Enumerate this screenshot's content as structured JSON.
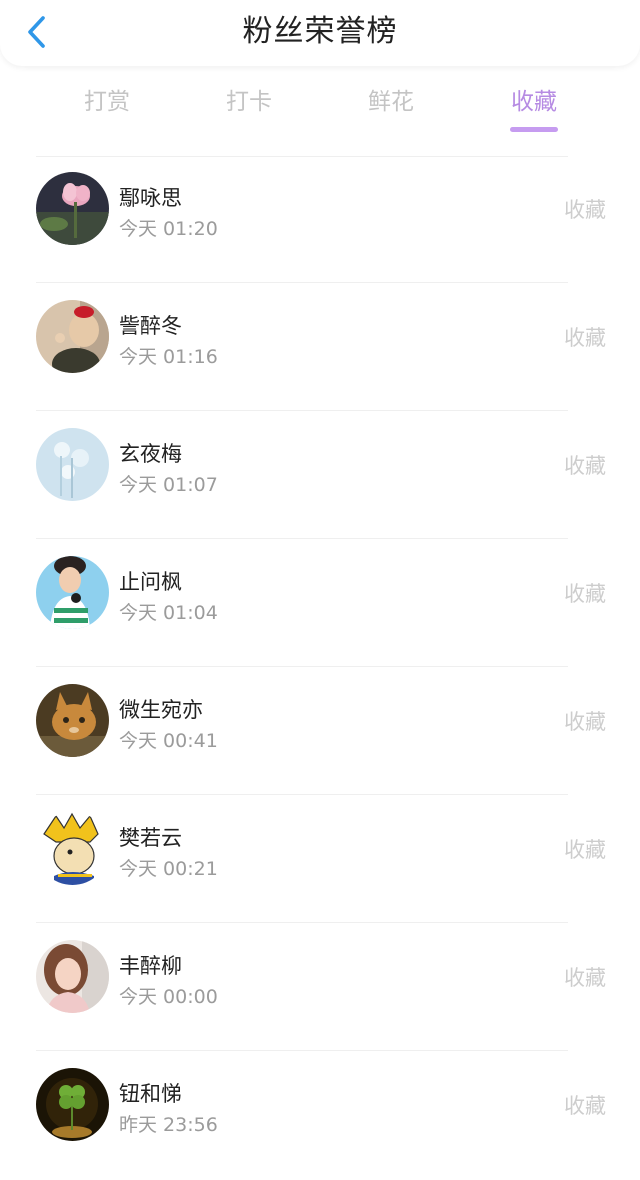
{
  "header": {
    "title": "粉丝荣誉榜"
  },
  "tabs": [
    {
      "label": "打赏"
    },
    {
      "label": "打卡"
    },
    {
      "label": "鲜花"
    },
    {
      "label": "收藏"
    }
  ],
  "active_tab_color": "#b68be3",
  "fans": [
    {
      "name": "鄢咏思",
      "time": "今天 01:20",
      "action": "收藏",
      "avatar": "pink-lotus-avatar"
    },
    {
      "name": "訾醉冬",
      "time": "今天 01:16",
      "action": "收藏",
      "avatar": "girl-red-bow-avatar"
    },
    {
      "name": "玄夜梅",
      "time": "今天 01:07",
      "action": "收藏",
      "avatar": "pale-blue-flowers-avatar"
    },
    {
      "name": "止问枫",
      "time": "今天 01:04",
      "action": "收藏",
      "avatar": "boy-headphones-avatar"
    },
    {
      "name": "微生宛亦",
      "time": "今天 00:41",
      "action": "收藏",
      "avatar": "orange-cat-avatar"
    },
    {
      "name": "樊若云",
      "time": "今天 00:21",
      "action": "收藏",
      "avatar": "cartoon-saiyan-avatar"
    },
    {
      "name": "丰醉柳",
      "time": "今天 00:00",
      "action": "收藏",
      "avatar": "woman-portrait-avatar"
    },
    {
      "name": "钮和悌",
      "time": "昨天 23:56",
      "action": "收藏",
      "avatar": "four-leaf-clover-avatar"
    }
  ]
}
